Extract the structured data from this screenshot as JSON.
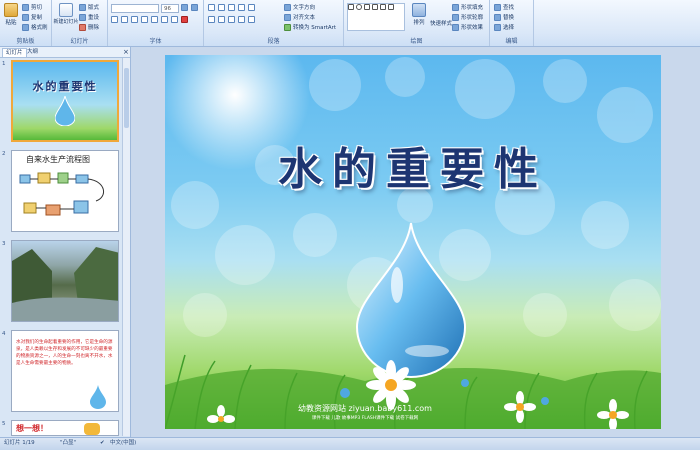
{
  "ribbon": {
    "clipboard": {
      "paste": "粘贴",
      "cut": "剪切",
      "copy": "复制",
      "format_painter": "格式刷",
      "label": "剪贴板"
    },
    "slides": {
      "new_slide": "新建幻灯片",
      "layout": "版式",
      "reset": "重设",
      "delete": "删除",
      "label": "幻灯片"
    },
    "font": {
      "font_name": "",
      "font_size": "96",
      "label": "字体"
    },
    "paragraph": {
      "text_direction": "文字方向",
      "align_text": "对齐文本",
      "convert_smartart": "转换为 SmartArt",
      "label": "段落"
    },
    "drawing": {
      "arrange": "排列",
      "quick_styles": "快速样式",
      "shape_fill": "形状填充",
      "shape_outline": "形状轮廓",
      "shape_effects": "形状效果",
      "label": "绘图"
    },
    "editing": {
      "find": "查找",
      "replace": "替换",
      "select": "选择",
      "label": "编辑"
    }
  },
  "panel": {
    "tabs": [
      "幻灯片",
      "大纲"
    ],
    "close": "×",
    "slide_numbers": [
      "1",
      "2",
      "3",
      "4",
      "5"
    ],
    "thumb1_title": "水的重要性",
    "thumb2_title": "自来水生产流程图",
    "thumb4_text": "水对我们的生命起着重要的作用，它是生命的源泉，是人类赖以生存和发展的不可缺少的最重要的物质资源之一，人的生命一刻也离不开水，水是人生命需要最主要的物质。",
    "thumb5_text": "想一想！"
  },
  "slide": {
    "title": "水的重要性",
    "footer_main": "幼教资源网站  ziyuan.baby611.com",
    "footer_sub": "课件下载  儿歌  故事MP3  FLASH课件下载  试卷下载网"
  },
  "status": {
    "slide_count": "幻灯片 1/19",
    "theme": "\"凸显\"",
    "language": "中文(中国)"
  }
}
